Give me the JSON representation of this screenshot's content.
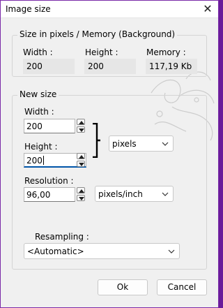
{
  "window": {
    "title": "Image size",
    "close_glyph": "✕"
  },
  "size_group": {
    "legend": "Size in pixels / Memory (Background)",
    "width_label": "Width :",
    "width_value": "200",
    "height_label": "Height :",
    "height_value": "200",
    "memory_label": "Memory :",
    "memory_value": "117,19 Kb"
  },
  "new_size": {
    "legend": "New size",
    "width_label": "Width :",
    "width_value": "200",
    "height_label": "Height :",
    "height_value": "200",
    "unit_selected": "pixels",
    "resolution_label": "Resolution :",
    "resolution_value": "96,00",
    "resolution_unit_selected": "pixels/inch",
    "resampling_label": "Resampling :",
    "resampling_selected": "<Automatic>"
  },
  "buttons": {
    "ok": "Ok",
    "cancel": "Cancel"
  },
  "colors": {
    "accent": "#0055a8",
    "frame": "#6a1b9a"
  },
  "icons": {
    "close": "close-icon",
    "spin_up": "chevron-up-icon",
    "spin_down": "chevron-down-icon",
    "dropdown": "chevron-down-icon"
  }
}
